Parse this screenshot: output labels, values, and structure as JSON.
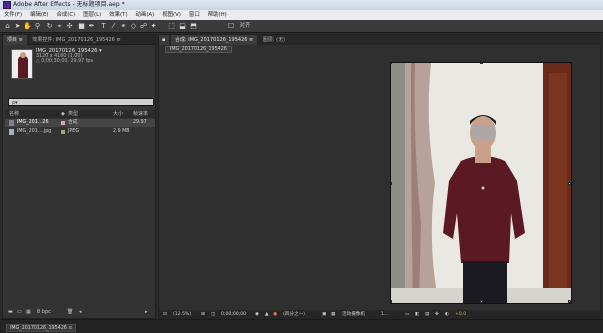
{
  "window": {
    "title": "Adobe After Effects - 无标题项目.aep *"
  },
  "menu": [
    "文件(F)",
    "编辑(E)",
    "合成(C)",
    "图层(L)",
    "效果(T)",
    "动画(A)",
    "视图(V)",
    "窗口",
    "帮助(H)"
  ],
  "toolbar": {
    "align_label": "对齐"
  },
  "project_panel": {
    "tabs": [
      "项目 ≡",
      "效果控件: IMG_20170126_195426 ≡"
    ],
    "selected_item": {
      "name": "IMG_20170126_195426 ▾",
      "dimensions": "3120 x 4160 (1.00)",
      "duration": "△ 0;00;30;00, 29.97 fps"
    },
    "search_placeholder": "ρ▾",
    "columns": [
      "名称",
      "类型",
      "大小",
      "帧速率"
    ],
    "items": [
      {
        "name": "IMG_201...26",
        "type": "合成",
        "size": "",
        "fps": "29.97"
      },
      {
        "name": "IMG_201....jpg",
        "type": "JPEG",
        "size": "2.9 MB",
        "fps": ""
      }
    ],
    "footer_bpc": "8 bpc"
  },
  "comp_panel": {
    "tabs": [
      "合成: IMG_20170126_195426 ≡",
      "图层: (无)"
    ],
    "subtab": "IMG_20170126_195426",
    "footer": {
      "zoom": "(12.5%)",
      "timecode": "0;00;00;00",
      "resolution": "(四分之一)",
      "camera": "活动摄像机",
      "views": "1...",
      "exposure": "+0.0"
    }
  },
  "timeline": {
    "tab_label": "IMG_20170126_195426 ≡"
  },
  "colors": {
    "panel_bg": "#2f2f2f",
    "shirt": "#5b1a23",
    "curtain": "#b59a94",
    "door": "#6b2a1a"
  }
}
